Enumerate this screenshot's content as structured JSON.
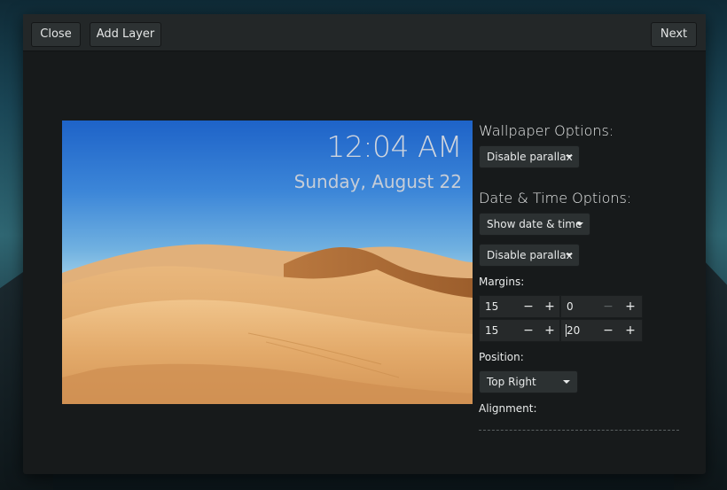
{
  "window": {
    "buttons": {
      "close": "Close",
      "add_layer": "Add Layer",
      "next": "Next"
    }
  },
  "preview": {
    "time": "12:04 AM",
    "date": "Sunday, August 22"
  },
  "wallpaper_options": {
    "heading": "Wallpaper Options:",
    "parallax": "Disable parallax"
  },
  "datetime_options": {
    "heading": "Date & Time Options:",
    "show": "Show date & time",
    "parallax": "Disable parallax",
    "margins_label": "Margins:",
    "margins": [
      {
        "value": "15",
        "minus": "−",
        "plus": "+"
      },
      {
        "value": "0",
        "minus": "−",
        "plus": "+"
      },
      {
        "value": "15",
        "minus": "−",
        "plus": "+"
      },
      {
        "value": "20",
        "minus": "−",
        "plus": "+"
      }
    ],
    "position_label": "Position:",
    "position": "Top Right",
    "alignment_label": "Alignment:"
  },
  "icons": [
    "caret-down-icon",
    "minus-icon",
    "plus-icon"
  ]
}
